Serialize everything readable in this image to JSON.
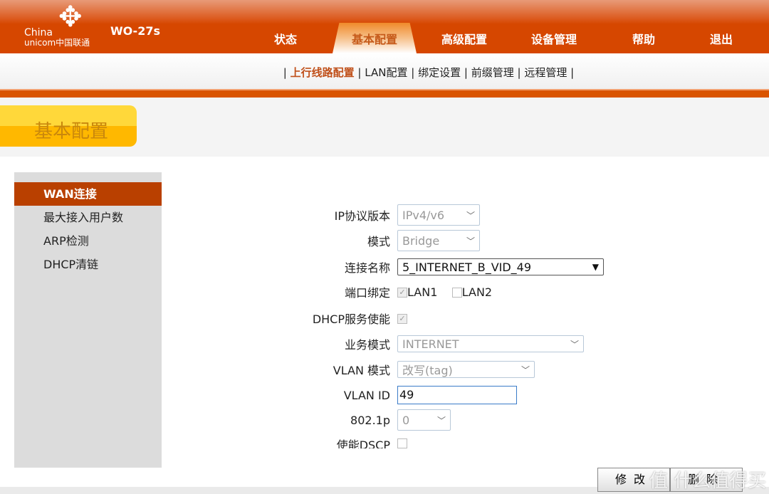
{
  "header": {
    "logo_text_1": "China",
    "logo_text_2": "unicom中国联通",
    "model": "WO-27s"
  },
  "nav": {
    "tabs": [
      {
        "label": "状态"
      },
      {
        "label": "基本配置"
      },
      {
        "label": "高级配置"
      },
      {
        "label": "设备管理"
      },
      {
        "label": "帮助"
      },
      {
        "label": "退出"
      }
    ],
    "active": "基本配置"
  },
  "subnav": {
    "items": [
      {
        "label": "上行线路配置"
      },
      {
        "label": "LAN配置"
      },
      {
        "label": "绑定设置"
      },
      {
        "label": "前缀管理"
      },
      {
        "label": "远程管理"
      }
    ],
    "separator": "|"
  },
  "page_title": "基本配置",
  "sidebar": {
    "items": [
      {
        "label": "WAN连接"
      },
      {
        "label": "最大接入用户数"
      },
      {
        "label": "ARP检测"
      },
      {
        "label": "DHCP清链"
      }
    ]
  },
  "form": {
    "ip_version": {
      "label": "IP协议版本",
      "value": "IPv4/v6"
    },
    "mode": {
      "label": "模式",
      "value": "Bridge"
    },
    "conn_name": {
      "label": "连接名称",
      "value": "5_INTERNET_B_VID_49"
    },
    "port_bind": {
      "label": "端口绑定",
      "lan1": "LAN1",
      "lan2": "LAN2",
      "lan1_checked": true,
      "lan2_checked": false
    },
    "dhcp": {
      "label": "DHCP服务使能",
      "checked": true
    },
    "service_mode": {
      "label": "业务模式",
      "value": "INTERNET"
    },
    "vlan_mode": {
      "label": "VLAN 模式",
      "value": "改写(tag)"
    },
    "vlan_id": {
      "label": "VLAN ID",
      "value": "49"
    },
    "p8021": {
      "label": "802.1p",
      "value": "0"
    },
    "dscp": {
      "label": "使能DSCP",
      "checked": false
    }
  },
  "buttons": {
    "modify": "修改",
    "delete": "删除"
  },
  "watermark": "值 什么值得买",
  "colors": {
    "brand": "#d64700",
    "sidebar_active": "#b94000",
    "title_yellow": "#ffd83a"
  }
}
